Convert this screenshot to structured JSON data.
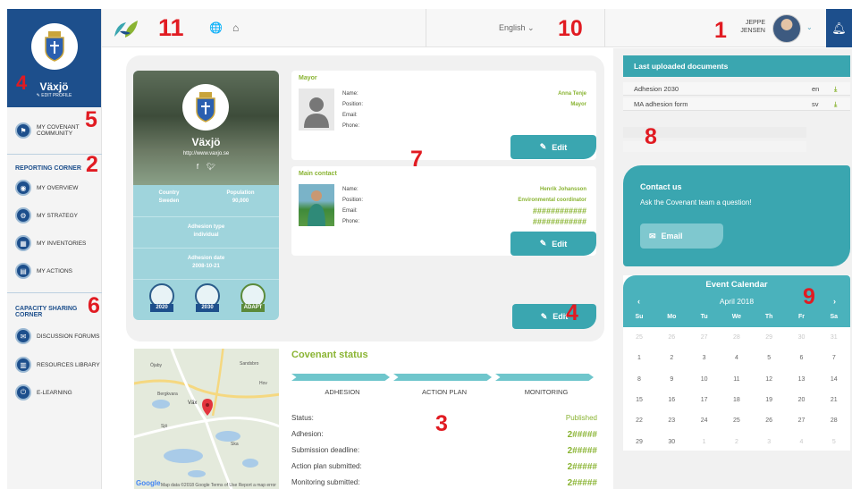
{
  "sidebar": {
    "city": "Växjö",
    "edit_profile": "EDIT PROFILE",
    "my_covenant": "MY COVENANT COMMUNITY",
    "reporting_heading": "REPORTING CORNER",
    "reporting_items": [
      "MY OVERVIEW",
      "MY STRATEGY",
      "MY INVENTORIES",
      "MY ACTIONS"
    ],
    "capacity_heading": "CAPACITY SHARING CORNER",
    "capacity_items": [
      "DISCUSSION FORUMS",
      "RESOURCES LIBRARY",
      "E-LEARNING"
    ]
  },
  "header": {
    "language": "English",
    "user_first": "JEPPE",
    "user_last": "JENSEN"
  },
  "profile_card": {
    "name": "Växjö",
    "url": "http://www.vaxjo.se",
    "country_label": "Country",
    "country": "Sweden",
    "population_label": "Population",
    "population": "90,000",
    "adhesion_type_label": "Adhesion type",
    "adhesion_type": "individual",
    "adhesion_date_label": "Adhesion date",
    "adhesion_date": "2008-10-21",
    "badges": [
      "2020",
      "2030",
      "ADAPT"
    ]
  },
  "contacts": {
    "field_labels": [
      "Name:",
      "Position:",
      "Email:",
      "Phone:"
    ],
    "mayor": {
      "title": "Mayor",
      "name": "Anna Tenje",
      "position": "Mayor"
    },
    "main": {
      "title": "Main contact",
      "name": "Henrik Johansson",
      "position": "Environmental coordinator",
      "email": "############",
      "phone": "############"
    },
    "edit_label": "Edit"
  },
  "map": {
    "attribution": "Map data ©2018 Google   Terms of Use   Report a map error",
    "google": "Google",
    "places": [
      "Öjaby",
      "Sandsbro",
      "Bergkvara",
      "Väx",
      "Sjö",
      "Ska",
      "Hov"
    ]
  },
  "status": {
    "title": "Covenant status",
    "stages": [
      "ADHESION",
      "ACTION PLAN",
      "MONITORING"
    ],
    "rows": [
      {
        "label": "Status:",
        "value": "Published"
      },
      {
        "label": "Adhesion:",
        "value": "2#####"
      },
      {
        "label": "Submission deadline:",
        "value": "2#####"
      },
      {
        "label": "Action plan submitted:",
        "value": "2#####"
      },
      {
        "label": "Monitoring submitted:",
        "value": "2#####"
      }
    ]
  },
  "documents": {
    "title": "Last uploaded documents",
    "rows": [
      {
        "name": "Adhesion 2030",
        "lang": "en"
      },
      {
        "name": "MA adhesion form",
        "lang": "sv"
      }
    ]
  },
  "contact_us": {
    "title": "Contact us",
    "subtitle": "Ask the Covenant team a question!",
    "button": "Email"
  },
  "calendar": {
    "title": "Event Calendar",
    "month": "April 2018",
    "weekdays": [
      "Su",
      "Mo",
      "Tu",
      "We",
      "Th",
      "Fr",
      "Sa"
    ],
    "weeks": [
      [
        "25",
        "26",
        "27",
        "28",
        "29",
        "30",
        "31"
      ],
      [
        "1",
        "2",
        "3",
        "4",
        "5",
        "6",
        "7"
      ],
      [
        "8",
        "9",
        "10",
        "11",
        "12",
        "13",
        "14"
      ],
      [
        "15",
        "16",
        "17",
        "18",
        "19",
        "20",
        "21"
      ],
      [
        "22",
        "23",
        "24",
        "25",
        "26",
        "27",
        "28"
      ],
      [
        "29",
        "30",
        "1",
        "2",
        "3",
        "4",
        "5"
      ]
    ]
  },
  "annotations": [
    "1",
    "2",
    "3",
    "4",
    "4",
    "5",
    "6",
    "7",
    "8",
    "9",
    "10",
    "11"
  ],
  "colors": {
    "navy": "#1d4f8c",
    "teal": "#3aa6b0",
    "green": "#8ab433",
    "marker": "#e11b22"
  }
}
